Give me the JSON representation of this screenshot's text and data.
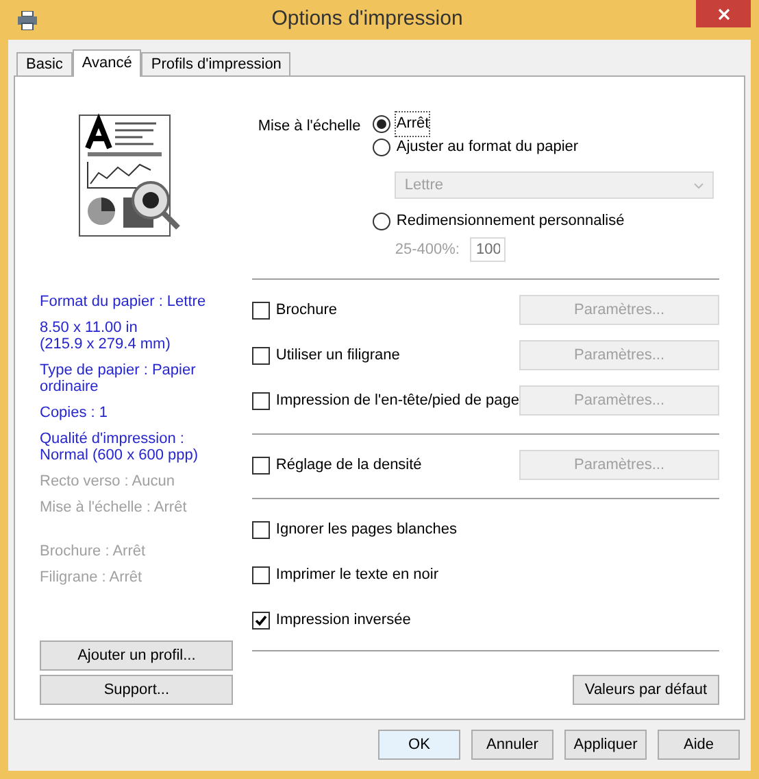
{
  "window": {
    "title": "Options d'impression"
  },
  "tabs": [
    {
      "label": "Basic",
      "selected": false
    },
    {
      "label": "Avancé",
      "selected": true
    },
    {
      "label": "Profils d'impression",
      "selected": false
    }
  ],
  "summary": [
    [
      {
        "text": "Format du papier : Lettre",
        "enabled": true
      },
      {
        "text": "8.50 x 11.00 in\n(215.9 x 279.4 mm)",
        "enabled": true
      },
      {
        "text": "Type de papier : Papier ordinaire",
        "enabled": true
      },
      {
        "text": "Copies : 1",
        "enabled": true
      },
      {
        "text": "Qualité d'impression : Normal (600 x 600 ppp)",
        "enabled": true
      },
      {
        "text": "Recto verso : Aucun",
        "enabled": false
      },
      {
        "text": "Mise à l'échelle : Arrêt",
        "enabled": false
      }
    ],
    [
      {
        "text": "Brochure : Arrêt",
        "enabled": false
      },
      {
        "text": "Filigrane : Arrêt",
        "enabled": false
      }
    ]
  ],
  "profile_buttons": [
    "Ajouter un profil...",
    "Support..."
  ],
  "scaling": {
    "label": "Mise à l'échelle",
    "options": [
      {
        "label": "Arrêt",
        "selected": true
      },
      {
        "label": "Ajuster au format du papier",
        "selected": false
      },
      {
        "label": "Redimensionnement personnalisé",
        "selected": false
      }
    ],
    "paper_select": {
      "value": "Lettre",
      "disabled": true
    },
    "range_label": "25-400%:",
    "percent": {
      "value": "100",
      "disabled": true
    }
  },
  "sections": [
    [
      {
        "label": "Brochure",
        "checked": false,
        "button": {
          "label": "Paramètres...",
          "disabled": true
        }
      },
      {
        "label": "Utiliser un filigrane",
        "checked": false,
        "button": {
          "label": "Paramètres...",
          "disabled": true
        }
      },
      {
        "label": "Impression de l'en-tête/pied de page",
        "checked": false,
        "button": {
          "label": "Paramètres...",
          "disabled": true
        }
      }
    ],
    [
      {
        "label": "Réglage de la densité",
        "checked": false,
        "button": {
          "label": "Paramètres...",
          "disabled": true
        }
      }
    ],
    [
      {
        "label": "Ignorer les pages blanches",
        "checked": false
      },
      {
        "label": "Imprimer le texte en noir",
        "checked": false
      },
      {
        "label": "Impression inversée",
        "checked": true
      }
    ]
  ],
  "defaults_button": "Valeurs par défaut",
  "dialog_buttons": [
    {
      "label": "OK",
      "default": true
    },
    {
      "label": "Annuler",
      "default": false
    },
    {
      "label": "Appliquer",
      "default": false
    },
    {
      "label": "Aide",
      "default": false
    }
  ]
}
